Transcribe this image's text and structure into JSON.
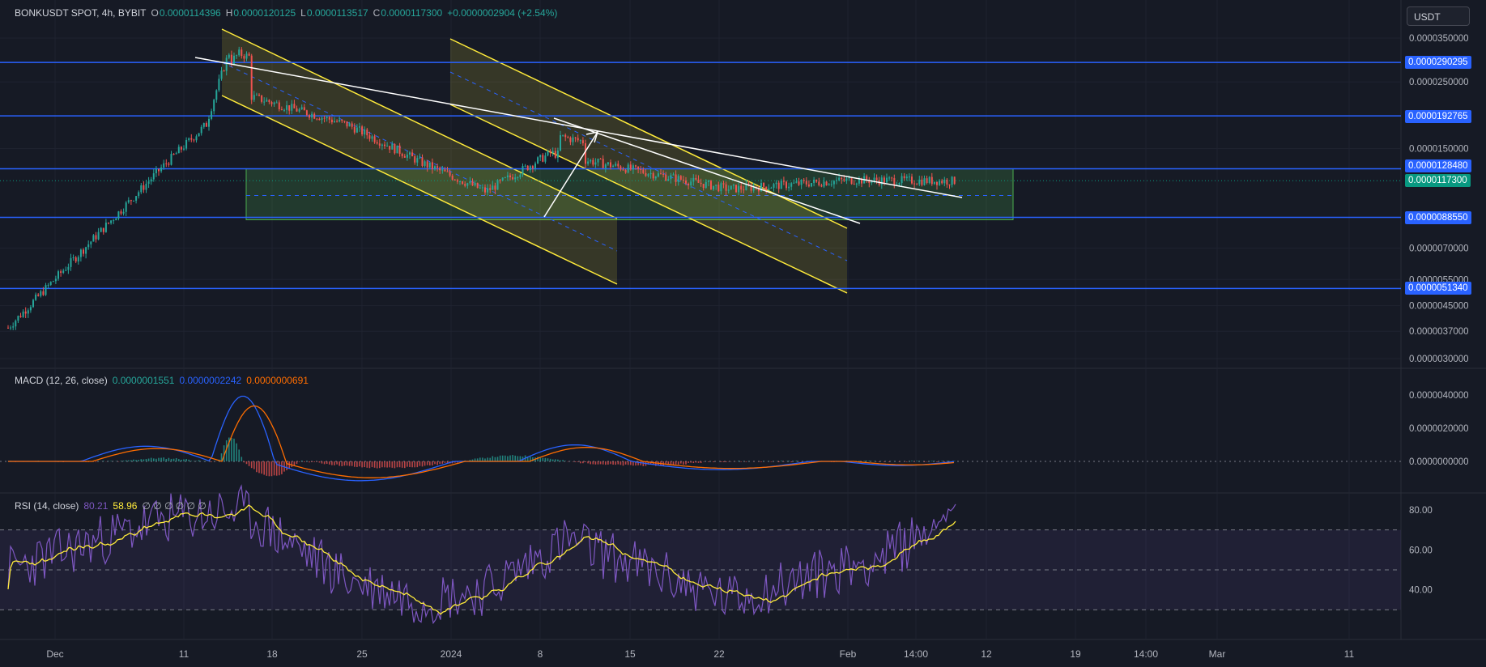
{
  "header": {
    "symbol": "BONKUSDT SPOT, 4h, BYBIT",
    "o_label": "O",
    "o_value": "0.0000114396",
    "h_label": "H",
    "h_value": "0.0000120125",
    "l_label": "L",
    "l_value": "0.0000113517",
    "c_label": "C",
    "c_value": "0.0000117300",
    "change": "+0.0000002904 (+2.54%)"
  },
  "currency_button": "USDT",
  "macd_legend": {
    "name": "MACD (12, 26, close)",
    "hist": "0.0000001551",
    "macd": "0.0000002242",
    "signal": "0.0000000691"
  },
  "rsi_legend": {
    "name": "RSI (14, close)",
    "rsi": "80.21",
    "ma": "58.96",
    "empties": "∅ ∅ ∅ ∅ ∅ ∅"
  },
  "colors": {
    "bg": "#161a25",
    "up": "#26a69a",
    "down": "#ef5350",
    "level": "#2962ff",
    "channel": "#ffeb3b",
    "zone": "#4caf50",
    "trend": "#ffffff",
    "macd": "#2962ff",
    "signal": "#ff6d00",
    "rsi": "#7e57c2",
    "rsi_ma": "#ffeb3b"
  },
  "chart_data": [
    {
      "type": "line",
      "name": "price",
      "y_scale": "log",
      "y_tick_labels": [
        "0.0000350000",
        "0.0000250000",
        "0.0000150000",
        "0.0000070000",
        "0.0000055000",
        "0.0000045000",
        "0.0000037000",
        "0.0000030000"
      ],
      "x_tick_labels": [
        "Dec",
        "11",
        "18",
        "25",
        "2024",
        "8",
        "15",
        "22",
        "Feb",
        "14:00",
        "12",
        "19",
        "14:00",
        "Mar",
        "11"
      ],
      "levels": [
        "0.0000290295",
        "0.0000192765",
        "0.0000128480",
        "0.0000088550",
        "0.0000051340"
      ],
      "last_price": "0.0000117300",
      "x": [
        "Dec",
        "11",
        "18",
        "25",
        "2024",
        "8",
        "15",
        "22",
        "Feb",
        "14:00"
      ],
      "close": [
        3.8e-06,
        1.3e-05,
        2.3e-05,
        1.8e-05,
        1.35e-05,
        1.08e-05,
        1.45e-05,
        1.1e-05,
        1.18e-05,
        1.17e-05
      ],
      "channels": [
        {
          "from": "11",
          "to": "8",
          "note": "descending channel 1"
        },
        {
          "from": "25",
          "to": "22",
          "note": "descending channel 2"
        }
      ],
      "zone": {
        "top": "0.0000128480",
        "bottom": "0.0000088550"
      }
    },
    {
      "type": "line",
      "name": "MACD (12, 26, close)",
      "y_tick_labels": [
        "0.0000040000",
        "0.0000020000",
        "0.0000000000"
      ],
      "series": [
        {
          "name": "MACD",
          "values": [
            0.0,
            1.5e-06,
            4.6e-06,
            0.0,
            -1.2e-06,
            0.0,
            1.2e-06,
            -4e-07,
            0.0,
            2e-07
          ]
        },
        {
          "name": "Signal",
          "values": [
            0.0,
            1.2e-06,
            3.8e-06,
            3e-07,
            -8e-07,
            0.0,
            1e-06,
            -3e-07,
            0.0,
            7e-08
          ]
        }
      ]
    },
    {
      "type": "line",
      "name": "RSI (14, close)",
      "y_tick_labels": [
        "80.00",
        "60.00",
        "40.00"
      ],
      "series": [
        {
          "name": "RSI",
          "values": [
            50,
            75,
            80,
            45,
            35,
            40,
            65,
            35,
            58,
            80.21
          ]
        },
        {
          "name": "MA",
          "values": [
            48,
            68,
            70,
            52,
            38,
            44,
            60,
            38,
            50,
            58.96
          ]
        }
      ]
    }
  ]
}
